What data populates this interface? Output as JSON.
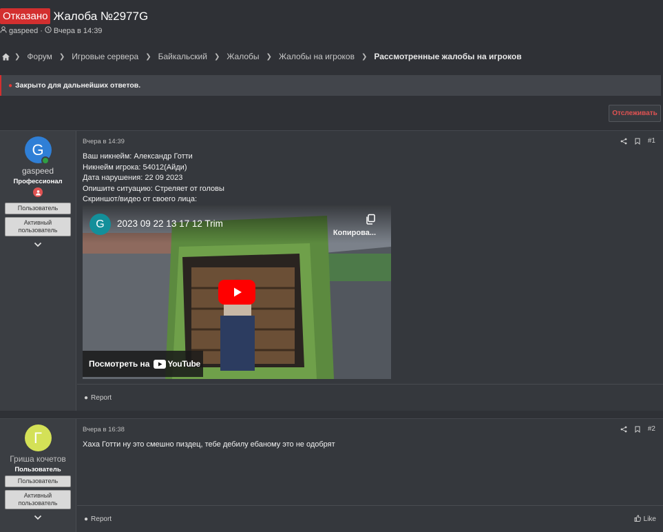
{
  "thread": {
    "status_label": "Отказано",
    "title": "Жалоба №2977G",
    "author": "gaspeed",
    "date": "Вчера в 14:39"
  },
  "breadcrumb": [
    "Форум",
    "Игровые сервера",
    "Байкальский",
    "Жалобы",
    "Жалобы на игроков",
    "Рассмотренные жалобы на игроков"
  ],
  "notice": {
    "text": "Закрыто для дальнейших ответов."
  },
  "actions": {
    "watch_label": "Отслеживать"
  },
  "posts": [
    {
      "avatar_letter": "G",
      "avatar_color": "#2f7fd6",
      "username": "gaspeed",
      "user_title": "Профессионал",
      "banners": [
        "Пользователь",
        "Активный пользователь"
      ],
      "date": "Вчера в 14:39",
      "number": "#1",
      "lines": [
        "Ваш никнейм: Александр Готти",
        "Никнейм игрока: 54012(Айди)",
        "Дата нарушения: 22 09 2023",
        "Опишите ситуацию: Стреляет от головы",
        "Скриншот/видео от своего лица:"
      ],
      "video": {
        "channel_letter": "G",
        "title": "2023 09 22 13 17 12 Trim",
        "copy_label": "Копирова...",
        "watch_label": "Посмотреть на",
        "yt_label": "YouTube"
      },
      "report_label": "Report"
    },
    {
      "avatar_letter": "Г",
      "avatar_color": "#d4e157",
      "username": "Гриша кочетов",
      "user_title": "Пользователь",
      "banners": [
        "Пользователь",
        "Активный пользователь"
      ],
      "date": "Вчера в 16:38",
      "number": "#2",
      "lines": [
        "Хаха Готти ну это смешно пиздец, тебе дебилу ебаному это не одобрят"
      ],
      "report_label": "Report",
      "like_label": "Like"
    }
  ],
  "colors": {
    "accent_red": "#d32f2f",
    "background": "#2f3136",
    "post_bg": "#35383d"
  }
}
